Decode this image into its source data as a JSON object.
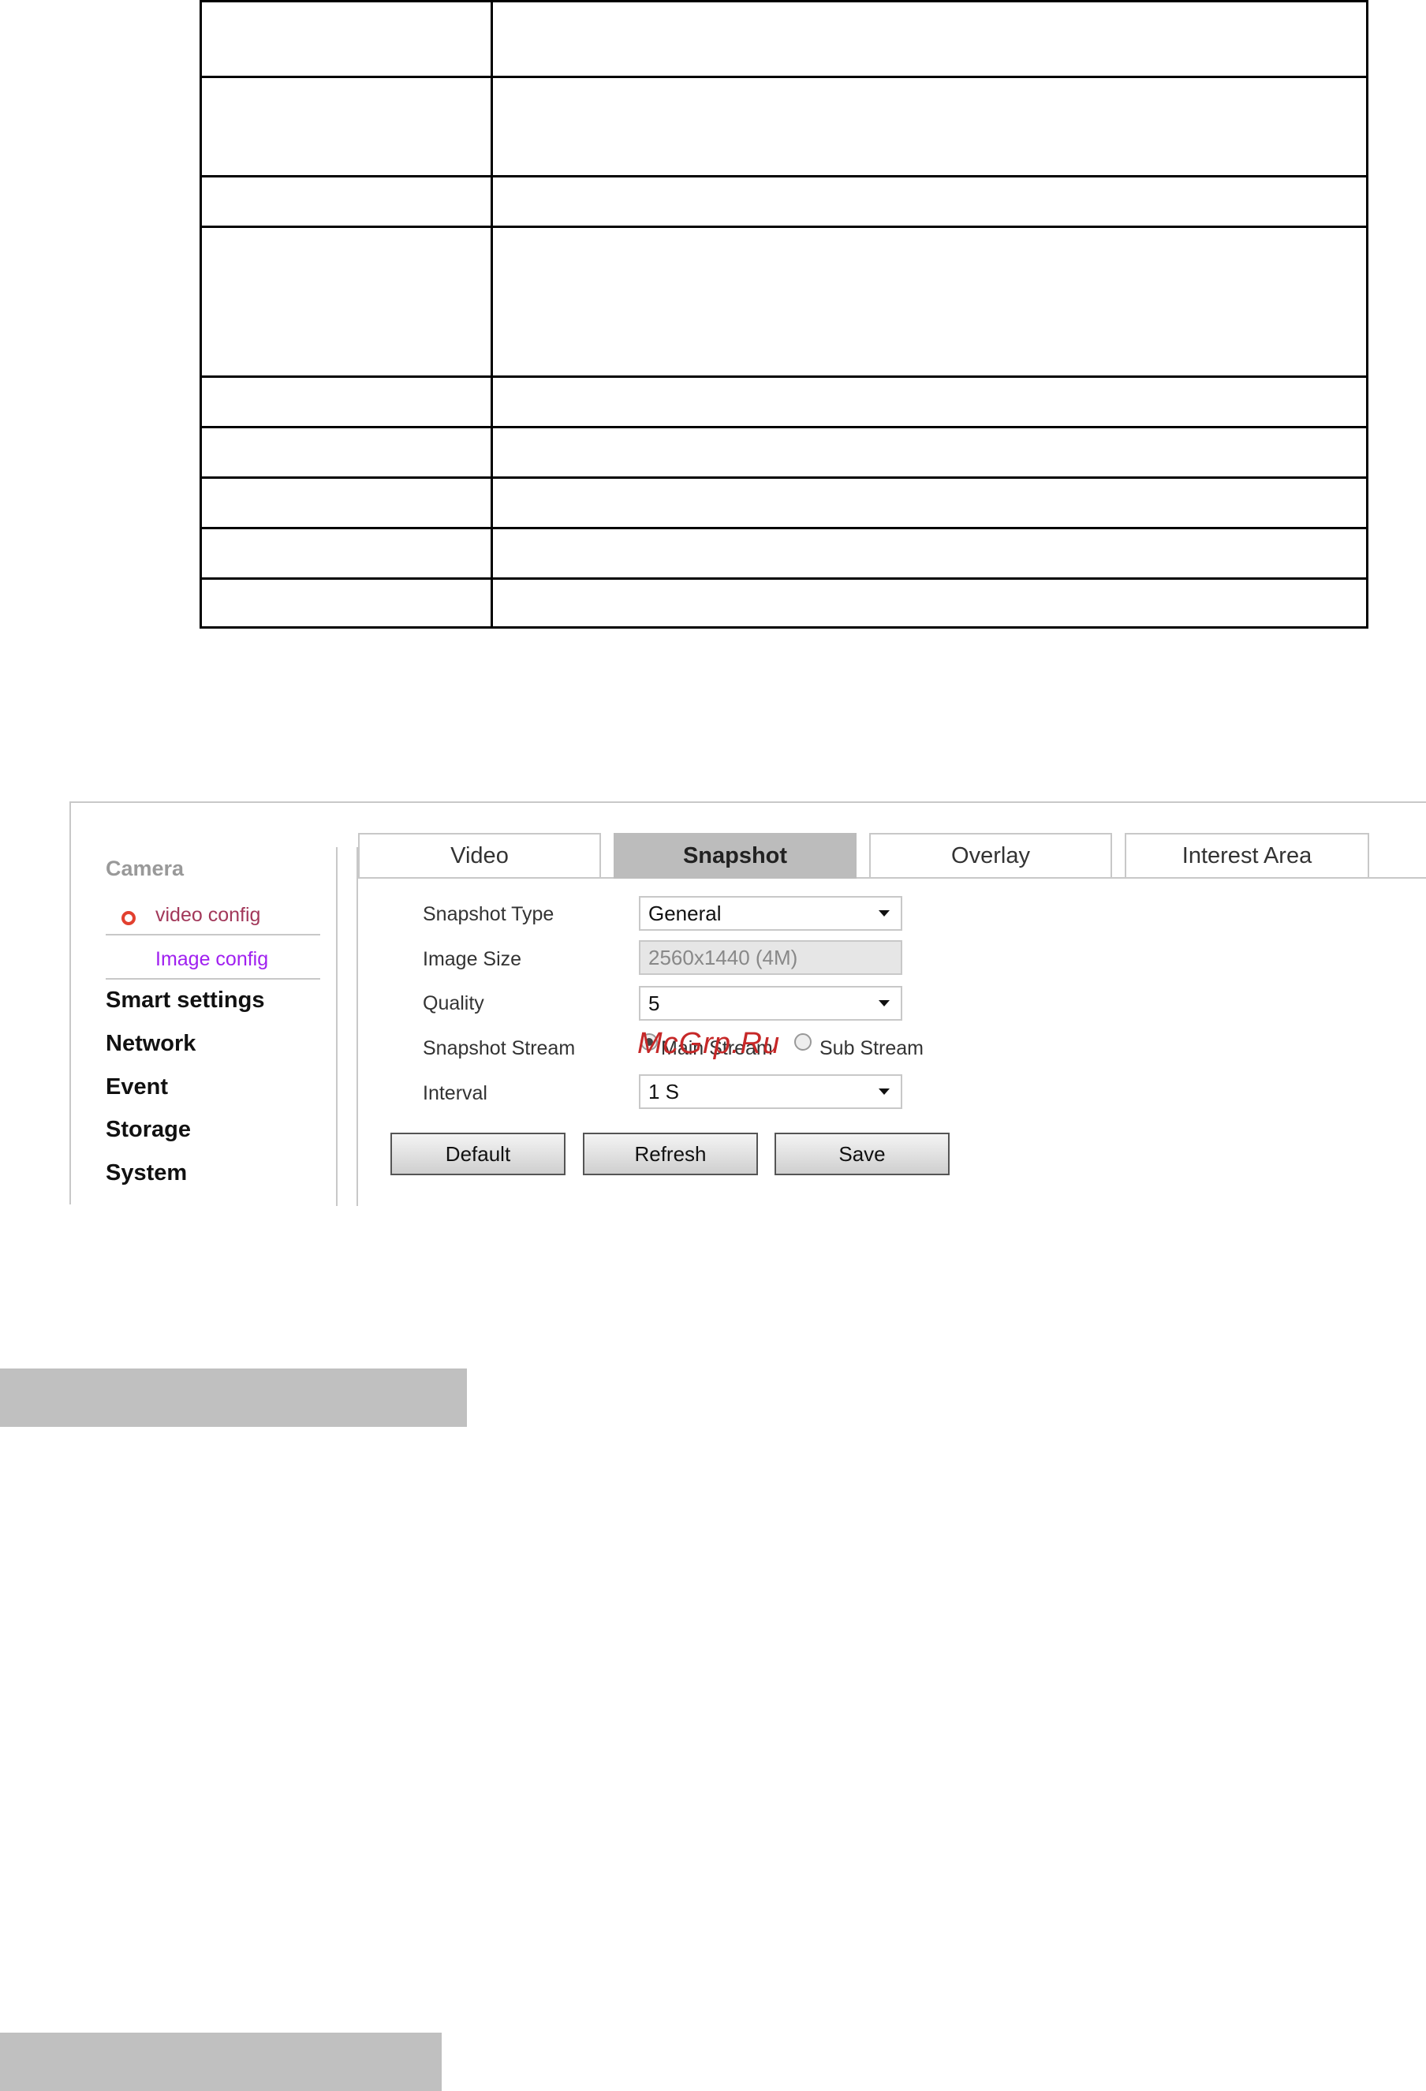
{
  "sidebar": {
    "camera": "Camera",
    "sub_items": [
      "video config",
      "Image config"
    ],
    "main_items": [
      "Smart settings",
      "Network",
      "Event",
      "Storage",
      "System"
    ]
  },
  "tabs": [
    {
      "label": "Video",
      "active": false
    },
    {
      "label": "Snapshot",
      "active": true
    },
    {
      "label": "Overlay",
      "active": false
    },
    {
      "label": "Interest Area",
      "active": false
    }
  ],
  "form": {
    "snapshot_type_label": "Snapshot Type",
    "snapshot_type_value": "General",
    "image_size_label": "Image Size",
    "image_size_value": "2560x1440 (4M)",
    "quality_label": "Quality",
    "quality_value": "5",
    "snapshot_stream_label": "Snapshot Stream",
    "stream_main": "Main Stream",
    "stream_sub": "Sub Stream",
    "interval_label": "Interval",
    "interval_value": "1 S"
  },
  "buttons": {
    "default": "Default",
    "refresh": "Refresh",
    "save": "Save"
  },
  "watermark": "McGrp.Ru",
  "colors": {
    "active_tab": "#bcbcbc",
    "selected_sub": "#a2385a",
    "link_sub": "#a020f0",
    "radio_dot": "#e2402f"
  }
}
